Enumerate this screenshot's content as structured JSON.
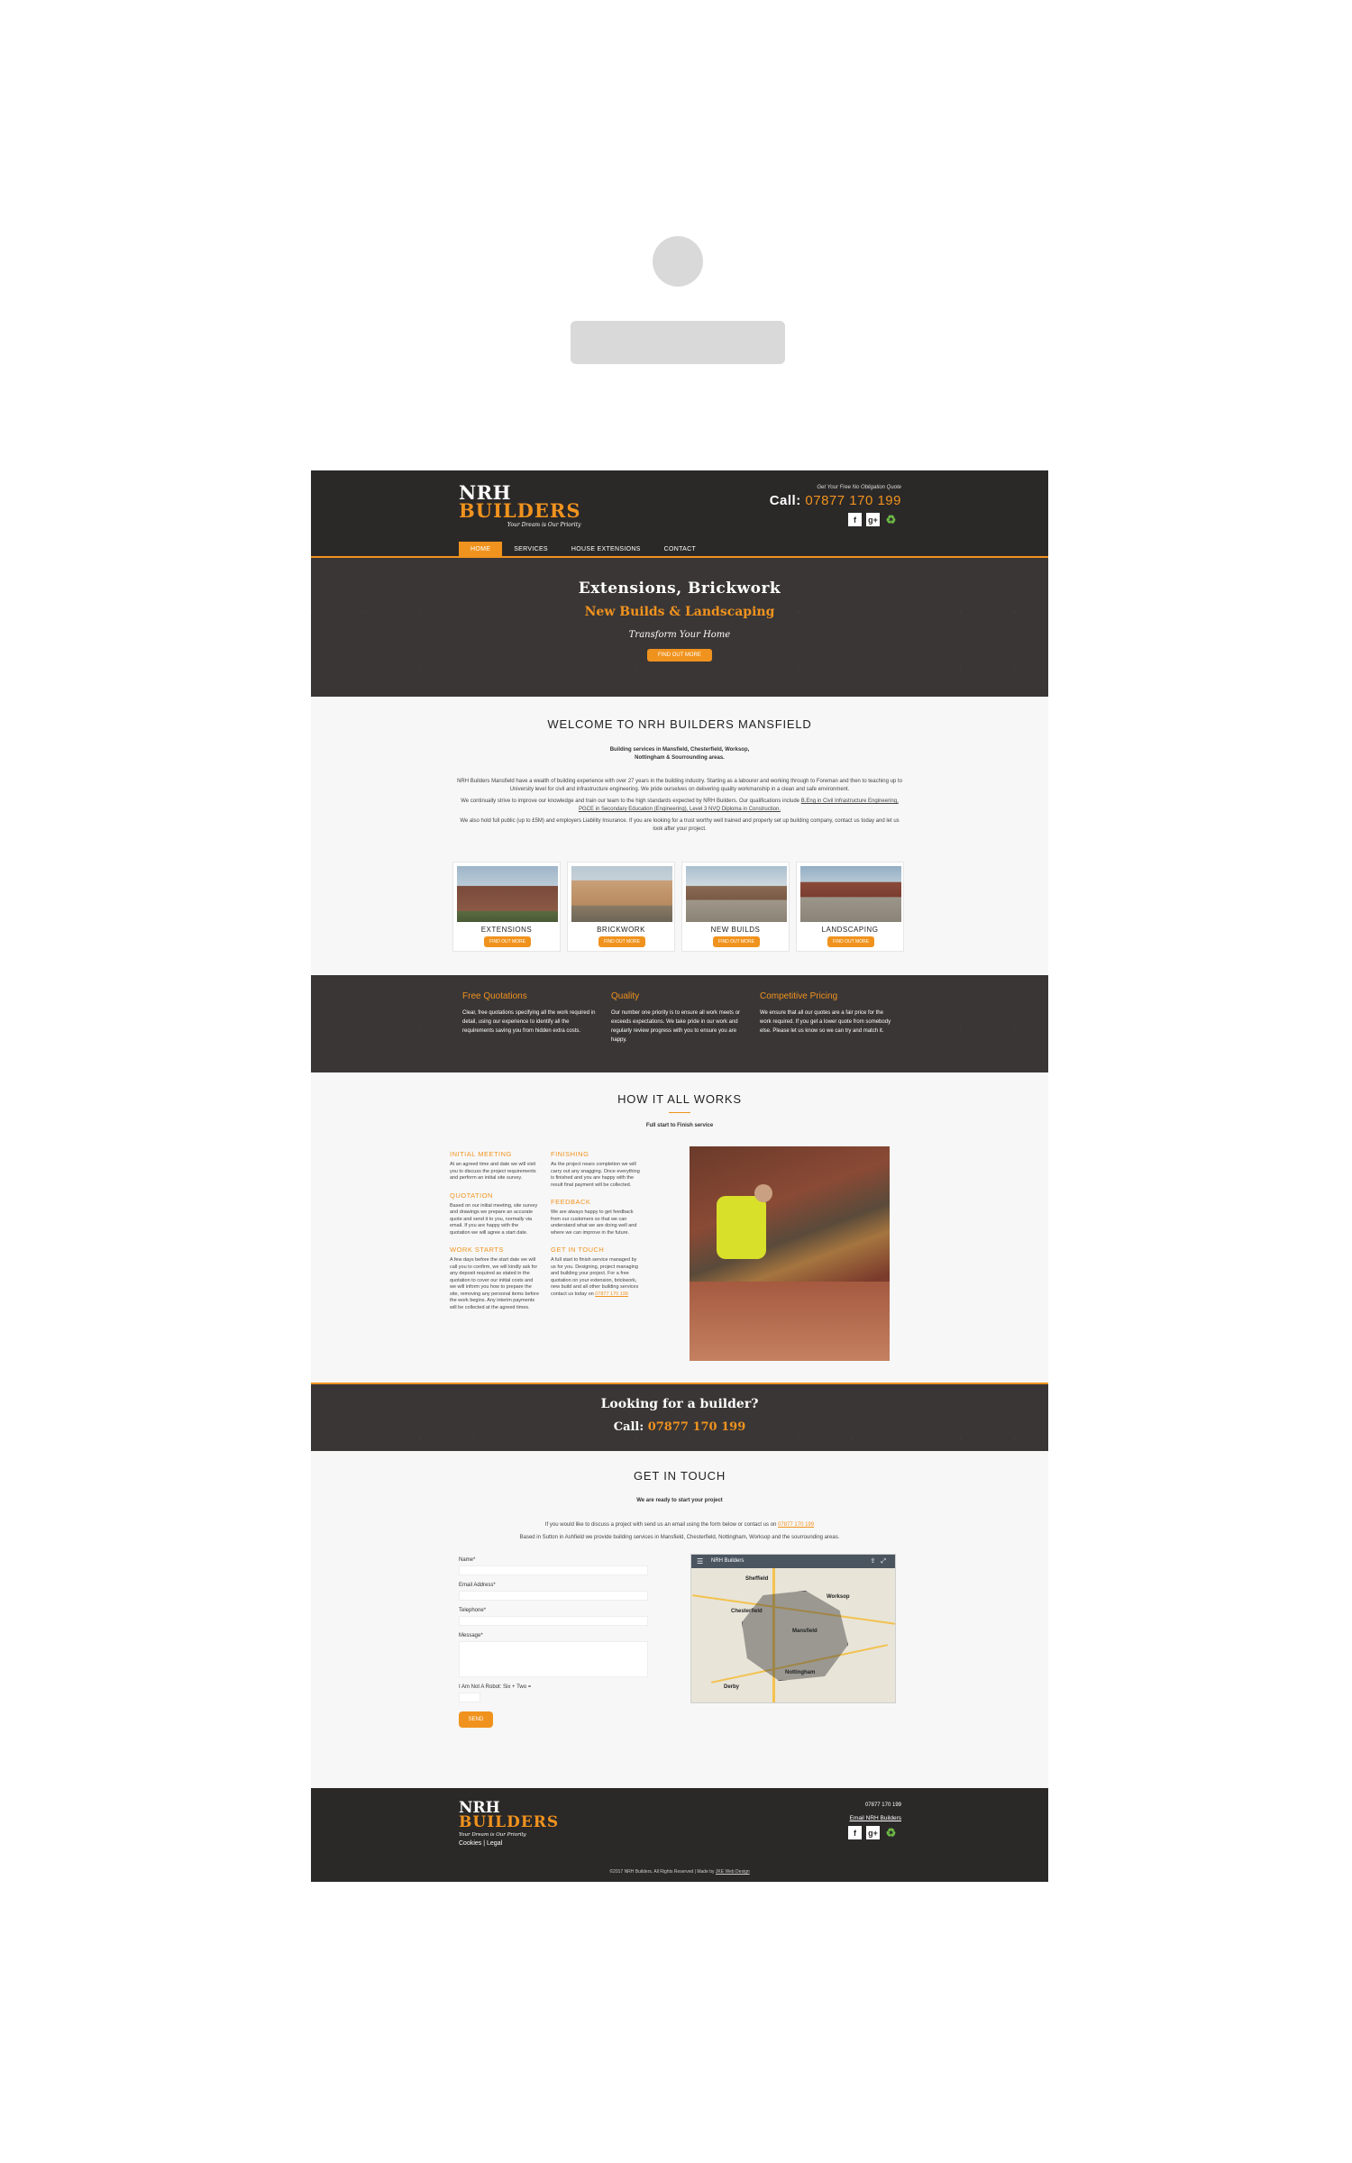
{
  "brand": {
    "line1": "NRH",
    "line2": "BUILDERS",
    "tagline": "Your Dream is Our Priority",
    "orange": "#f0931e",
    "dark": "#2b2828"
  },
  "header": {
    "quote_text": "Get Your Free No Obligation Quote",
    "call_label": "Call:",
    "phone": "07877 170 199",
    "social": [
      {
        "icon": "facebook-icon",
        "glyph": "f"
      },
      {
        "icon": "google-plus-icon",
        "glyph": "g+"
      },
      {
        "icon": "leaf-icon",
        "glyph": "♻"
      }
    ]
  },
  "nav": {
    "items": [
      {
        "label": "HOME",
        "active": true
      },
      {
        "label": "SERVICES"
      },
      {
        "label": "HOUSE EXTENSIONS"
      },
      {
        "label": "CONTACT"
      }
    ]
  },
  "hero": {
    "title": "Extensions, Brickwork",
    "subtitle": "New Builds & Landscaping",
    "tagline": "Transform Your Home",
    "button": "FIND OUT MORE"
  },
  "welcome": {
    "title": "WELCOME TO NRH BUILDERS MANSFIELD",
    "subtitle": "Building services in Mansfield, Chesterfield, Worksop, Nottingham & Sourrounding areas.",
    "p1": "NRH Builders Mansfield have a wealth of building experience with over 27 years in the building industry. Starting as a labourer and working through to Foreman and then to teaching up to University level for civil and infrastructure engineering. We pride ourselves on delivering quality workmanship in a clean and safe environment.",
    "p2_start": "We continually strive to improve our knowledge and train our team to the high standards expected by NRH Builders. Our qualifications include",
    "p2_quals": "B.Eng in Civil Infrastructure Engineering, PGCE in Secondary Education (Engineering), Level 3 NVQ Diploma in Construction.",
    "p3": "We also hold full public (up to £5M) and employers Liability Insurance. If you are looking for a trust worthy well trained and properly set up building company, contact us today and let us look after your project."
  },
  "services": [
    {
      "label": "EXTENSIONS",
      "button": "FIND OUT MORE"
    },
    {
      "label": "BRICKWORK",
      "button": "FIND OUT MORE"
    },
    {
      "label": "NEW BUILDS",
      "button": "FIND OUT MORE"
    },
    {
      "label": "LANDSCAPING",
      "button": "FIND OUT MORE"
    }
  ],
  "features": [
    {
      "title": "Free Quotations",
      "text": "Clear, free quotations specifying all the work required in detail, using our experience to identify all the requirements saving you from hidden extra costs."
    },
    {
      "title": "Quality",
      "text": "Our number one priority is to ensure all work meets or exceeds expectations. We take pride in our work and regularly review progress with you to ensure you are happy."
    },
    {
      "title": "Competitive Pricing",
      "text": "We ensure that all our quotes are a fair price for the work required. If you get a lower quote from somebody else. Please let us know so we can try and match it."
    }
  ],
  "how": {
    "title": "HOW IT ALL WORKS",
    "subtitle": "Full start to Finish service",
    "col1": [
      {
        "title": "INITIAL MEETING",
        "text": "At an agreed time and date we will visit you to discuss the project requirements and perform an initial site survey."
      },
      {
        "title": "QUOTATION",
        "text": "Based on our initial meeting, site survey and drawings we prepare an accurate quote and send it to you, normally via email. If you are happy with the quotation we will agree a start date."
      },
      {
        "title": "WORK STARTS",
        "text": "A few days before the start date we will call you to confirm, we will kindly ask for any deposit required as stated in the quotation to cover our initial costs and we will inform you how to prepare the site, removing any personal items before the work begins. Any interim payments will be collected at the agreed times."
      }
    ],
    "col2": [
      {
        "title": "FINISHING",
        "text": "As the project nears completion we will carry out any snagging. Once everything is finished and you are happy with the result final payment will be collected."
      },
      {
        "title": "FEEDBACK",
        "text": "We are always happy to get feedback from our customers so that we can understand what we are doing well and where we can improve in the future."
      },
      {
        "title": "GET IN TOUCH",
        "text": "A full start to finish service managed by us for you. Designing, project managing and building your project. For a free quotation on your extension, brickwork, new build and all other building services contact us today on",
        "link": "07877 170 199"
      }
    ]
  },
  "cta": {
    "heading": "Looking for a builder?",
    "call_label": "Call:",
    "phone": "07877 170 199"
  },
  "contact": {
    "title": "GET IN TOUCH",
    "subtitle": "We are ready to start your project",
    "line1": "If you would like to discuss a project with send us an email using the form below or contact us on",
    "line1_link": "07877 170 199",
    "line2": "Based in Sutton in Ashfield we provide building services in Mansfield, Chesterfield, Nottingham, Worksop and the sourrounding areas.",
    "fields": {
      "name": "Name*",
      "email": "Email Address*",
      "telephone": "Telephone*",
      "message": "Message*",
      "robot": "I Am Not A Robot: Six + Two ="
    },
    "send": "SEND",
    "map_title": "NRH Builders",
    "map_places": [
      "Sheffield",
      "Chesterfield",
      "Mansfield",
      "Nottingham",
      "Derby",
      "Worksop"
    ]
  },
  "footer": {
    "phone": "07877 170 199",
    "email": "Email NRH Builders",
    "links": [
      "Cookies",
      "Legal"
    ],
    "copyright": "©2017 NRH Builders. All Rights Reserved | Made by",
    "credit": "JKE Web Design"
  }
}
